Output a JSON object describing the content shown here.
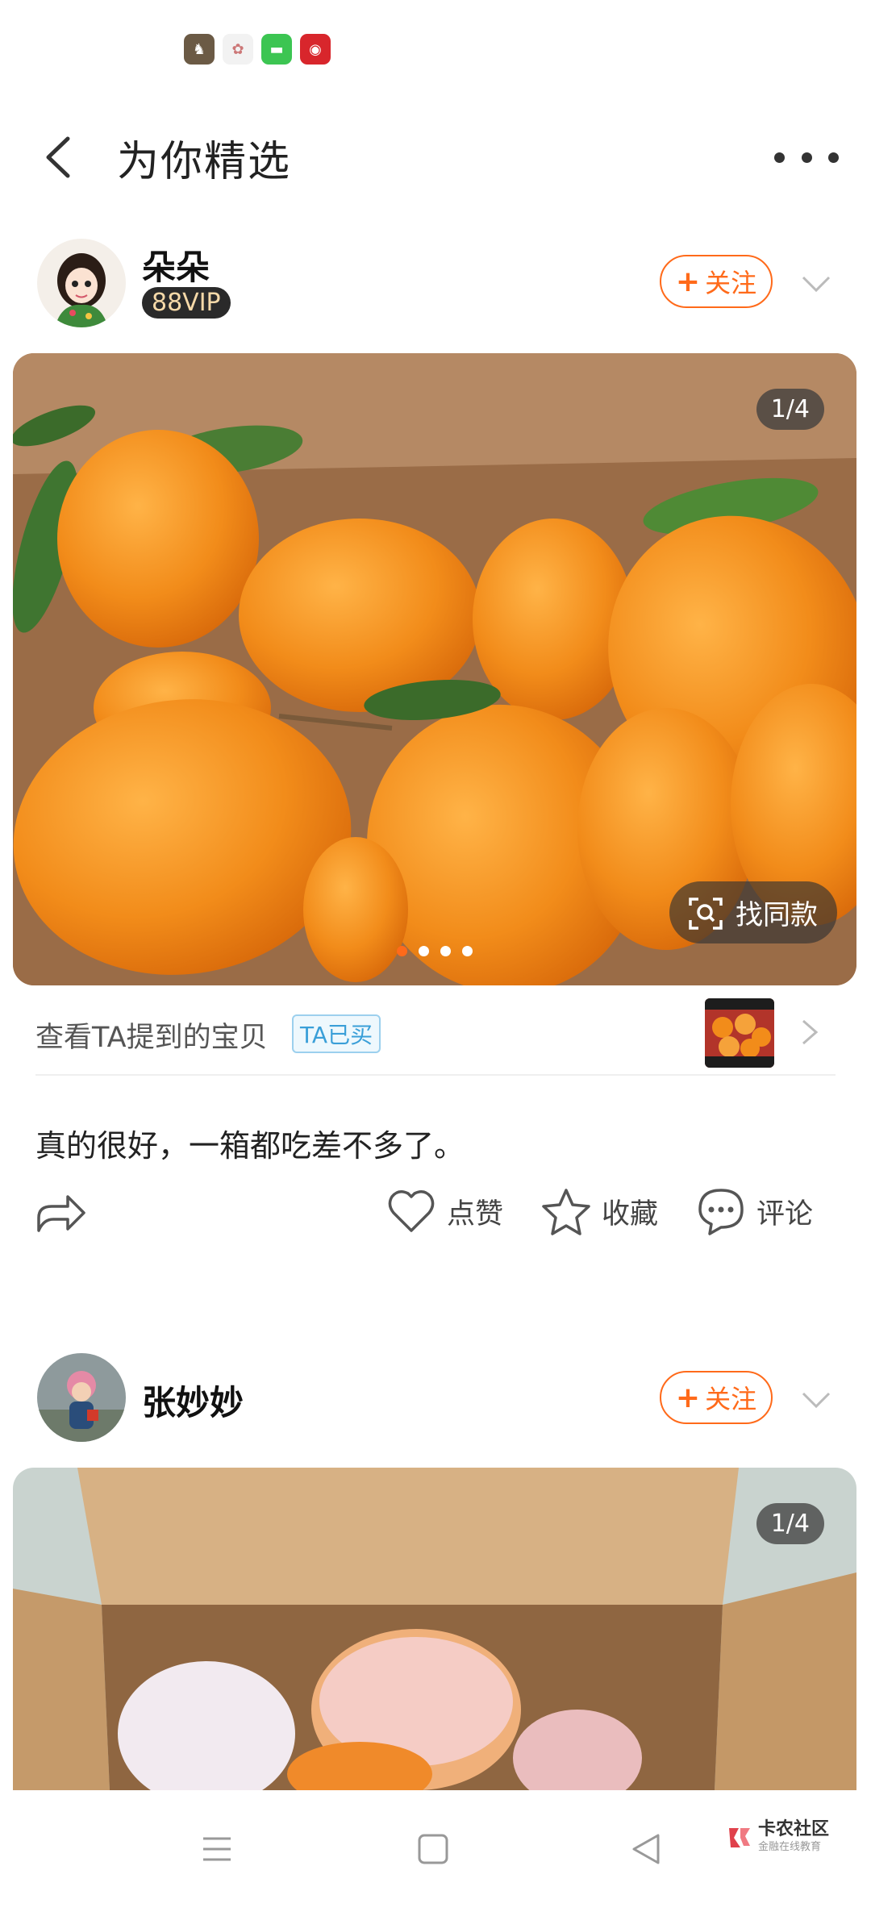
{
  "header": {
    "title": "为你精选"
  },
  "posts": [
    {
      "user": "朵朵",
      "vip": "88VIP",
      "follow": "关注",
      "page_indicator": "1/4",
      "find_same": "找同款",
      "mention": "查看TA提到的宝贝",
      "mention_tag": "TA已买",
      "text": "真的很好，一箱都吃差不多了。",
      "actions": {
        "like": "点赞",
        "collect": "收藏",
        "comment": "评论"
      }
    },
    {
      "user": "张妙妙",
      "follow": "关注",
      "page_indicator": "1/4"
    }
  ],
  "watermark": {
    "title": "卡农社区",
    "subtitle": "金融在线教育"
  },
  "colors": {
    "accent": "#ff6a1a",
    "tag_blue": "#3a9fd8"
  }
}
